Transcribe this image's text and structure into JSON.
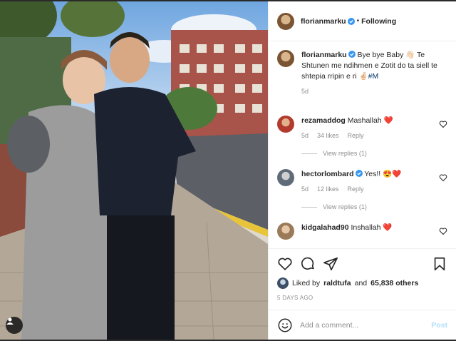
{
  "header": {
    "username": "florianmarku",
    "separator": "•",
    "follow_label": "Following"
  },
  "caption": {
    "username": "florianmarku",
    "text": "Bye bye Baby 👋🏻 Te Shtunen me ndihmen e Zotit do ta siell te shtepia rripin e ri 🤞🏻",
    "hashtag": "#M",
    "age": "5d"
  },
  "comments": [
    {
      "username": "rezamaddog",
      "text": "Mashallah ❤️",
      "age": "5d",
      "likes": "34 likes",
      "reply_label": "Reply",
      "view_replies": "View replies (1)"
    },
    {
      "username": "hectorlombard",
      "text": "Yes!! 😍❤️",
      "age": "5d",
      "likes": "12 likes",
      "reply_label": "Reply",
      "view_replies": "View replies (1)"
    },
    {
      "username": "kidgalahad90",
      "text": "Inshallah ❤️"
    }
  ],
  "liked_by": {
    "prefix": "Liked by",
    "user": "raldtufa",
    "conjunction": "and",
    "others": "65,838 others"
  },
  "timestamp": "5 DAYS AGO",
  "add_comment": {
    "placeholder": "Add a comment...",
    "post_label": "Post"
  },
  "icons": [
    "verified-badge-icon",
    "heart-icon",
    "comment-icon",
    "share-icon",
    "bookmark-icon",
    "emoji-icon",
    "user-tag-icon"
  ],
  "colors": {
    "verified_blue": "#3897f0",
    "text": "#262626",
    "muted": "#8e8e8e",
    "post_button_disabled": "#b2dffc",
    "hashtag": "#00376b"
  }
}
